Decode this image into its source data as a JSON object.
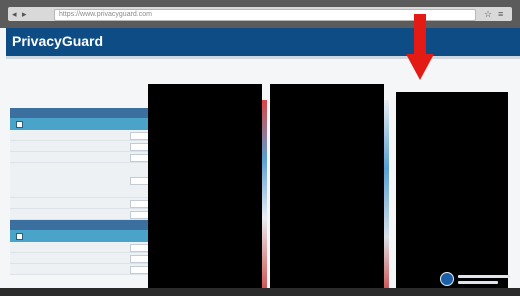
{
  "browser": {
    "url_text": "https://www.privacyguard.com",
    "back_glyph": "◂",
    "forward_glyph": "▸",
    "star_glyph": "☆",
    "menu_glyph": "≡"
  },
  "app": {
    "brand": "PrivacyGuard"
  },
  "header": {
    "links": [
      "",
      ""
    ]
  },
  "panels": [
    {
      "title": "",
      "bar_text": ""
    },
    {
      "title": "",
      "bar_text": ""
    }
  ],
  "annotation": {
    "arrow_color": "#e31b14"
  },
  "colors": {
    "brand_bar": "#0d4c84",
    "panel_header": "#3b6f9f",
    "panel_bar": "#4aa3c8",
    "redaction": "#000000"
  },
  "icons": [
    "globe-icon",
    "red-arrow-icon",
    "checkbox-icon"
  ]
}
